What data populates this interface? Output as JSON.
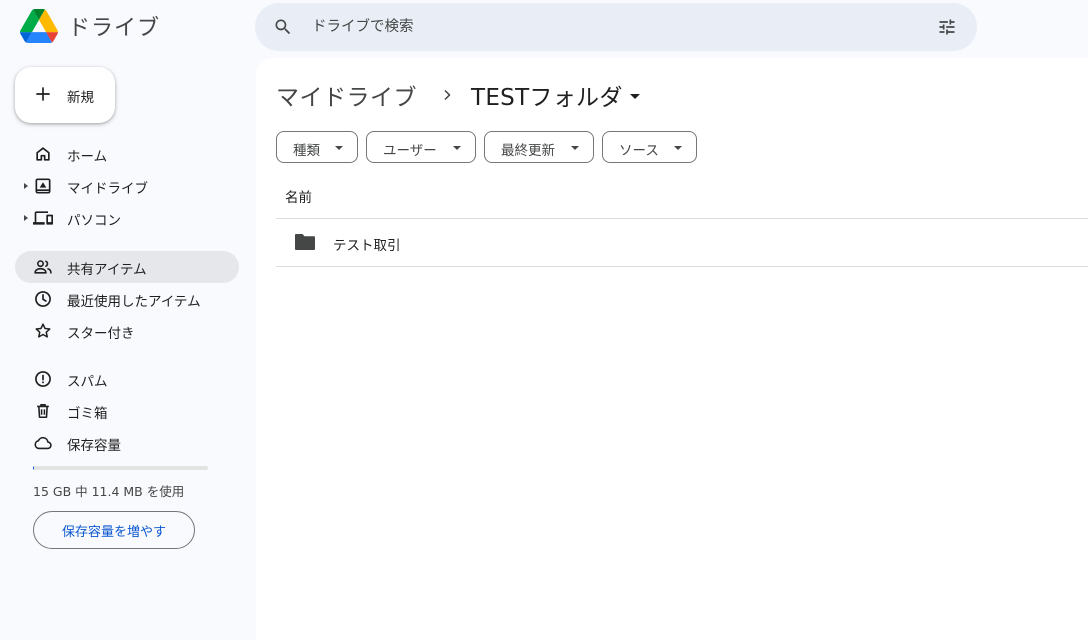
{
  "header": {
    "app_title": "ドライブ",
    "search_placeholder": "ドライブで検索"
  },
  "new_button": {
    "label": "新規"
  },
  "sidebar": {
    "items": [
      {
        "label": "ホーム",
        "icon": "home-icon"
      },
      {
        "label": "マイドライブ",
        "icon": "my-drive-icon",
        "expandable": true
      },
      {
        "label": "パソコン",
        "icon": "computers-icon",
        "expandable": true
      },
      {
        "label": "共有アイテム",
        "icon": "people-icon",
        "active": true
      },
      {
        "label": "最近使用したアイテム",
        "icon": "clock-icon"
      },
      {
        "label": "スター付き",
        "icon": "star-icon"
      },
      {
        "label": "スパム",
        "icon": "spam-icon"
      },
      {
        "label": "ゴミ箱",
        "icon": "trash-icon"
      },
      {
        "label": "保存容量",
        "icon": "cloud-icon"
      }
    ],
    "storage": {
      "text": "15 GB 中 11.4 MB を使用",
      "used_fraction": 0.0008,
      "button_label": "保存容量を増やす"
    }
  },
  "main": {
    "breadcrumb": {
      "root": "マイドライブ",
      "current": "TESTフォルダ"
    },
    "filters": [
      {
        "label": "種類"
      },
      {
        "label": "ユーザー"
      },
      {
        "label": "最終更新"
      },
      {
        "label": "ソース"
      }
    ],
    "column_header": "名前",
    "rows": [
      {
        "name": "テスト取引",
        "icon": "folder-icon"
      }
    ]
  },
  "colors": {
    "accent": "#0b57d0",
    "sidebar_bg": "#f8fafd",
    "search_bg": "#e9eef6",
    "active_item_bg": "#e5e7eb"
  }
}
